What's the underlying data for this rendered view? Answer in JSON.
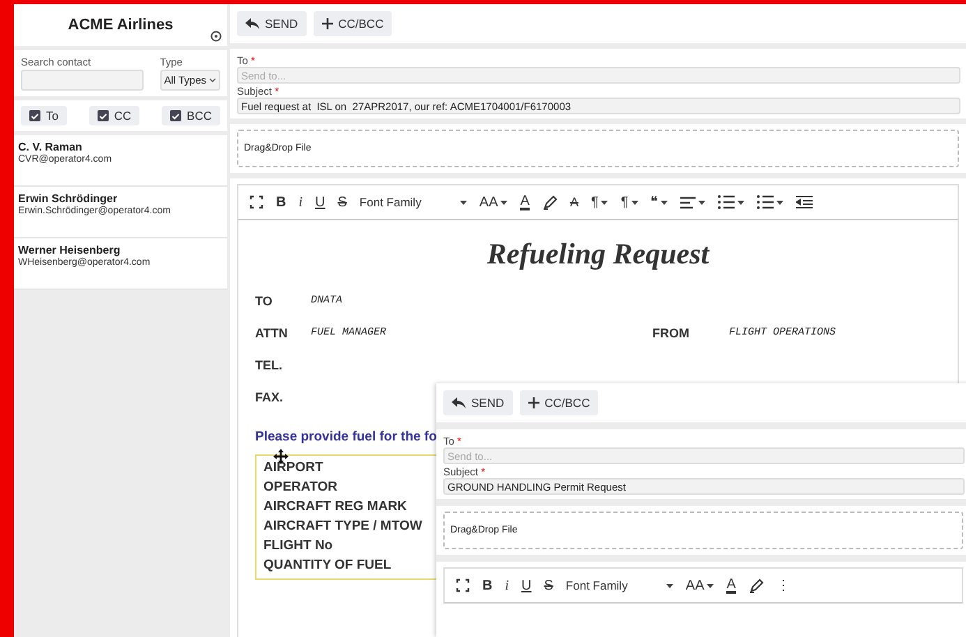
{
  "sidebar": {
    "title": "ACME Airlines",
    "search": {
      "label": "Search contact"
    },
    "type_filter": {
      "label": "Type",
      "value": "All Types"
    },
    "recipient_toggles": [
      {
        "label": "To",
        "checked": true
      },
      {
        "label": "CC",
        "checked": true
      },
      {
        "label": "BCC",
        "checked": true
      }
    ],
    "contacts": [
      {
        "name": "C. V. Raman",
        "email": "CVR@operator4.com"
      },
      {
        "name": "Erwin Schrödinger",
        "email": "Erwin.Schrödinger@operator4.com"
      },
      {
        "name": "Werner Heisenberg",
        "email": "WHeisenberg@operator4.com"
      }
    ]
  },
  "composer": {
    "actions": [
      {
        "kind": "send",
        "label": "SEND"
      },
      {
        "kind": "add",
        "label": "CC/BCC"
      }
    ],
    "to": {
      "label": "To",
      "mark": "*",
      "placeholder": "Send to..."
    },
    "subject": {
      "label": "Subject",
      "mark": "*",
      "value": "Fuel request at  ISL on  27APR2017, our ref: ACME1704001/F6170003"
    },
    "dropzone": "Drag&Drop File",
    "toolbar": [
      {
        "kind": "fullscreen"
      },
      {
        "kind": "bold",
        "label": "B"
      },
      {
        "kind": "italic",
        "label": "i"
      },
      {
        "kind": "underline",
        "label": "U"
      },
      {
        "kind": "strike",
        "label": "S"
      },
      {
        "kind": "font",
        "label": "Font Family",
        "caret": true
      },
      {
        "kind": "size",
        "label": "AA",
        "caret": true
      },
      {
        "kind": "color",
        "label": "A"
      },
      {
        "kind": "marker"
      },
      {
        "kind": "clear",
        "label": "A"
      },
      {
        "kind": "text",
        "label": "¶",
        "caret": true
      },
      {
        "kind": "text",
        "label": "¶",
        "caret": true
      },
      {
        "kind": "text",
        "label": "❝",
        "caret": true
      },
      {
        "kind": "align",
        "caret": true
      },
      {
        "kind": "olist",
        "caret": true
      },
      {
        "kind": "ulist",
        "caret": true
      },
      {
        "kind": "indent"
      }
    ],
    "document": {
      "title": "Refueling Request",
      "header_rows": [
        {
          "label": "TO",
          "value": "DNATA"
        },
        {
          "label": "ATTN",
          "value": "FUEL MANAGER",
          "side_label": "FROM",
          "side_value": "FLIGHT OPERATIONS"
        },
        {
          "label": "TEL."
        },
        {
          "label": "FAX."
        }
      ],
      "intro": "Please provide fuel for the fo",
      "fields": [
        "AIRPORT",
        "OPERATOR",
        "AIRCRAFT REG MARK",
        "AIRCRAFT TYPE / MTOW",
        "FLIGHT No",
        "QUANTITY OF FUEL"
      ]
    }
  },
  "popup_composer": {
    "actions": [
      {
        "kind": "send",
        "label": "SEND"
      },
      {
        "kind": "add",
        "label": "CC/BCC"
      }
    ],
    "to": {
      "label": "To",
      "mark": "*",
      "placeholder": "Send to..."
    },
    "subject": {
      "label": "Subject",
      "mark": "*",
      "value": "GROUND HANDLING Permit Request"
    },
    "dropzone": "Drag&Drop File",
    "toolbar": [
      {
        "kind": "fullscreen"
      },
      {
        "kind": "bold",
        "label": "B"
      },
      {
        "kind": "italic",
        "label": "i"
      },
      {
        "kind": "underline",
        "label": "U"
      },
      {
        "kind": "strike",
        "label": "S"
      },
      {
        "kind": "font",
        "label": "Font Family",
        "caret": true
      },
      {
        "kind": "size",
        "label": "AA",
        "caret": true
      },
      {
        "kind": "color",
        "label": "A"
      },
      {
        "kind": "marker"
      },
      {
        "kind": "more",
        "label": "⋮"
      }
    ]
  }
}
